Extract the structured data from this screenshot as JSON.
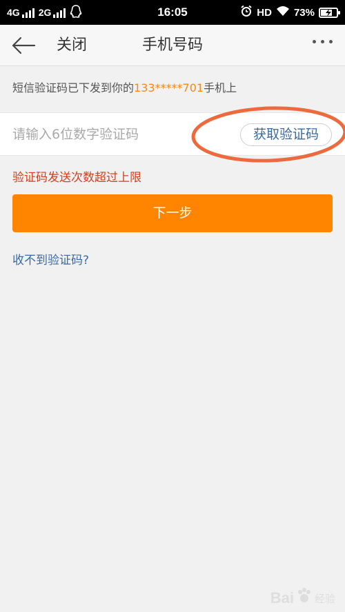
{
  "status_bar": {
    "network1": "4G",
    "network2": "2G",
    "time": "16:05",
    "hd": "HD",
    "battery": "73%",
    "battery_level": 0.73
  },
  "header": {
    "close_label": "关闭",
    "title": "手机号码",
    "more_icon": "more-dots-icon",
    "back_icon": "back-arrow-icon"
  },
  "info": {
    "prefix": "短信验证码已下发到你的",
    "phone": "133*****701",
    "suffix": "手机上"
  },
  "code_input": {
    "placeholder": "请输入6位数字验证码",
    "value": ""
  },
  "get_code_label": "获取验证码",
  "error_text": "验证码发送次数超过上限",
  "next_label": "下一步",
  "help_link": "收不到验证码?",
  "watermark": {
    "text": "Bai",
    "suffix": "经验"
  },
  "colors": {
    "accent_orange": "#ff8400",
    "phone_orange": "#f08a1b",
    "error_red": "#d23f1c",
    "link_blue": "#3a6aa0",
    "annotation_circle": "#ec6b3e"
  }
}
